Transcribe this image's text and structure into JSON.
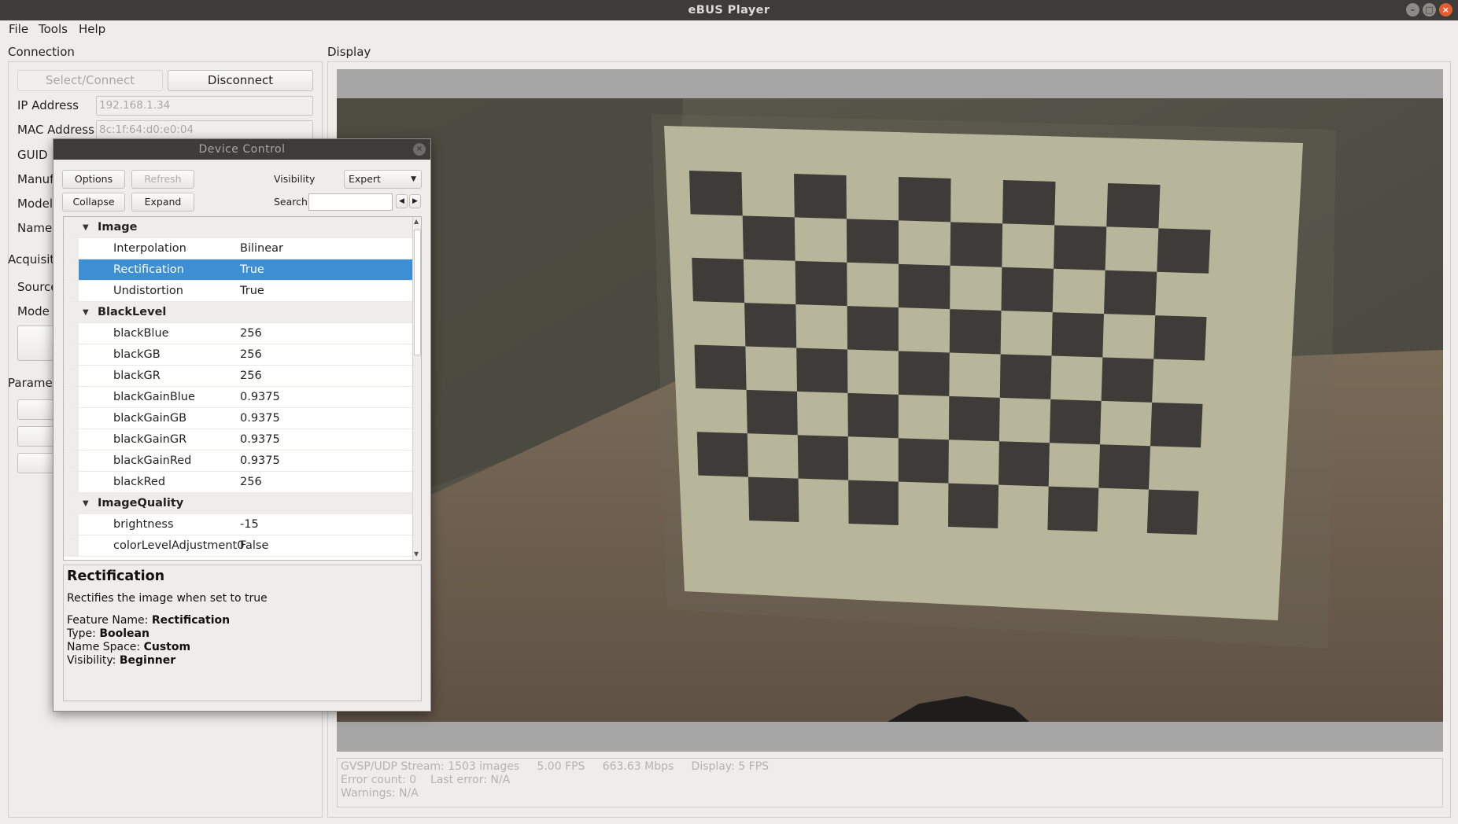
{
  "window": {
    "title": "eBUS Player"
  },
  "menu": [
    "File",
    "Tools",
    "Help"
  ],
  "connection": {
    "group_label": "Connection",
    "select_connect_label": "Select/Connect",
    "disconnect_label": "Disconnect",
    "fields": [
      {
        "label": "IP Address",
        "value": "192.168.1.34"
      },
      {
        "label": "MAC Address",
        "value": "8c:1f:64:d0:e0:04"
      },
      {
        "label": "GUID",
        "value": ""
      },
      {
        "label": "Manufa",
        "value": ""
      },
      {
        "label": "Model",
        "value": ""
      },
      {
        "label": "Name",
        "value": ""
      }
    ]
  },
  "acquisition": {
    "group_label": "Acquisiti",
    "source_label": "Source",
    "mode_label": "Mode"
  },
  "parameters": {
    "group_label": "Paramet"
  },
  "display": {
    "group_label": "Display",
    "stats": {
      "line1": "GVSP/UDP Stream: 1503 images     5.00 FPS     663.63 Mbps     Display: 5 FPS",
      "line2": "Error count: 0    Last error: N/A",
      "line3": "Warnings: N/A"
    }
  },
  "device_control": {
    "title": "Device Control",
    "options_label": "Options",
    "refresh_label": "Refresh",
    "collapse_label": "Collapse",
    "expand_label": "Expand",
    "visibility_label": "Visibility",
    "visibility_value": "Expert",
    "search_label": "Search",
    "search_value": "",
    "tree": [
      {
        "type": "category",
        "name": "Image"
      },
      {
        "type": "feature",
        "name": "Interpolation",
        "value": "Bilinear"
      },
      {
        "type": "feature",
        "name": "Rectification",
        "value": "True",
        "selected": true
      },
      {
        "type": "feature",
        "name": "Undistortion",
        "value": "True"
      },
      {
        "type": "category",
        "name": "BlackLevel"
      },
      {
        "type": "feature",
        "name": "blackBlue",
        "value": "256"
      },
      {
        "type": "feature",
        "name": "blackGB",
        "value": "256"
      },
      {
        "type": "feature",
        "name": "blackGR",
        "value": "256"
      },
      {
        "type": "feature",
        "name": "blackGainBlue",
        "value": "0.9375"
      },
      {
        "type": "feature",
        "name": "blackGainGB",
        "value": "0.9375"
      },
      {
        "type": "feature",
        "name": "blackGainGR",
        "value": "0.9375"
      },
      {
        "type": "feature",
        "name": "blackGainRed",
        "value": "0.9375"
      },
      {
        "type": "feature",
        "name": "blackRed",
        "value": "256"
      },
      {
        "type": "category",
        "name": "ImageQuality"
      },
      {
        "type": "feature",
        "name": "brightness",
        "value": "-15"
      },
      {
        "type": "feature",
        "name": "colorLevelAdjustment0",
        "value": "False"
      }
    ],
    "description": {
      "title": "Rectification",
      "text": "Rectifies the image when set to true",
      "feature_name_label": "Feature Name:",
      "feature_name": "Rectification",
      "type_label": "Type:",
      "type": "Boolean",
      "namespace_label": "Name Space:",
      "namespace": "Custom",
      "visibility_label": "Visibility:",
      "visibility": "Beginner"
    }
  },
  "colors": {
    "selection": "#3c8fd2",
    "titlebar": "#3d3c39",
    "close_button": "#e65c2e"
  }
}
